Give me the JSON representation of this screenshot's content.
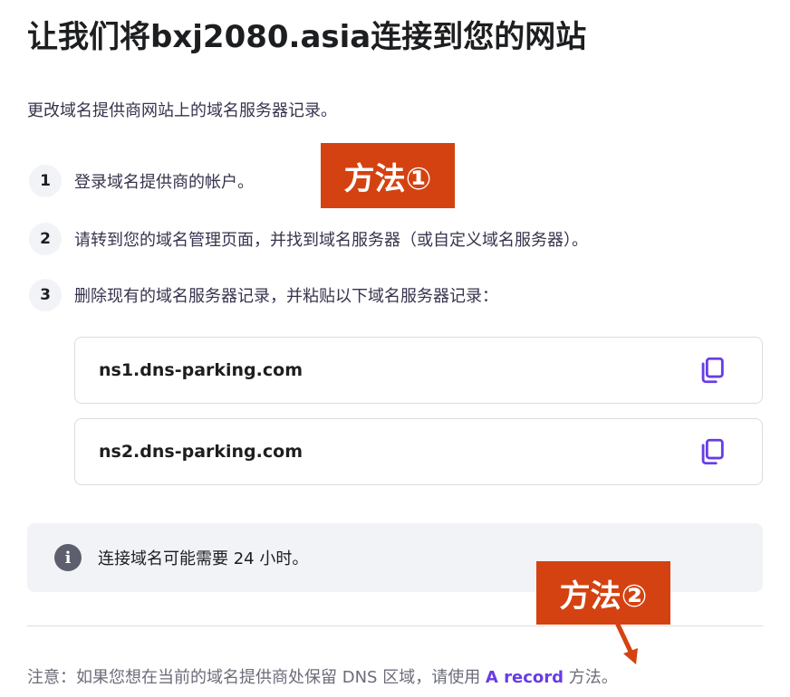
{
  "page": {
    "title": "让我们将bxj2080.asia连接到您的网站",
    "subtitle": "更改域名提供商网站上的域名服务器记录。"
  },
  "steps": [
    {
      "number": "1",
      "text": "登录域名提供商的帐户。"
    },
    {
      "number": "2",
      "text": "请转到您的域名管理页面，并找到域名服务器（或自定义域名服务器）。"
    },
    {
      "number": "3",
      "text": "删除现有的域名服务器记录，并粘贴以下域名服务器记录："
    }
  ],
  "nameservers": [
    {
      "value": "ns1.dns-parking.com",
      "icon": "copy-icon"
    },
    {
      "value": "ns2.dns-parking.com",
      "icon": "copy-icon"
    }
  ],
  "info": {
    "icon": "info-icon",
    "text": "连接域名可能需要 24 小时。"
  },
  "note": {
    "prefix": "注意：如果您想在当前的域名提供商处保留 DNS 区域，请使用 ",
    "link": "A record",
    "suffix": " 方法。"
  },
  "annotations": {
    "method1": "方法①",
    "method2": "方法②"
  },
  "colors": {
    "accent": "#673de6",
    "annotation": "#d44211"
  }
}
